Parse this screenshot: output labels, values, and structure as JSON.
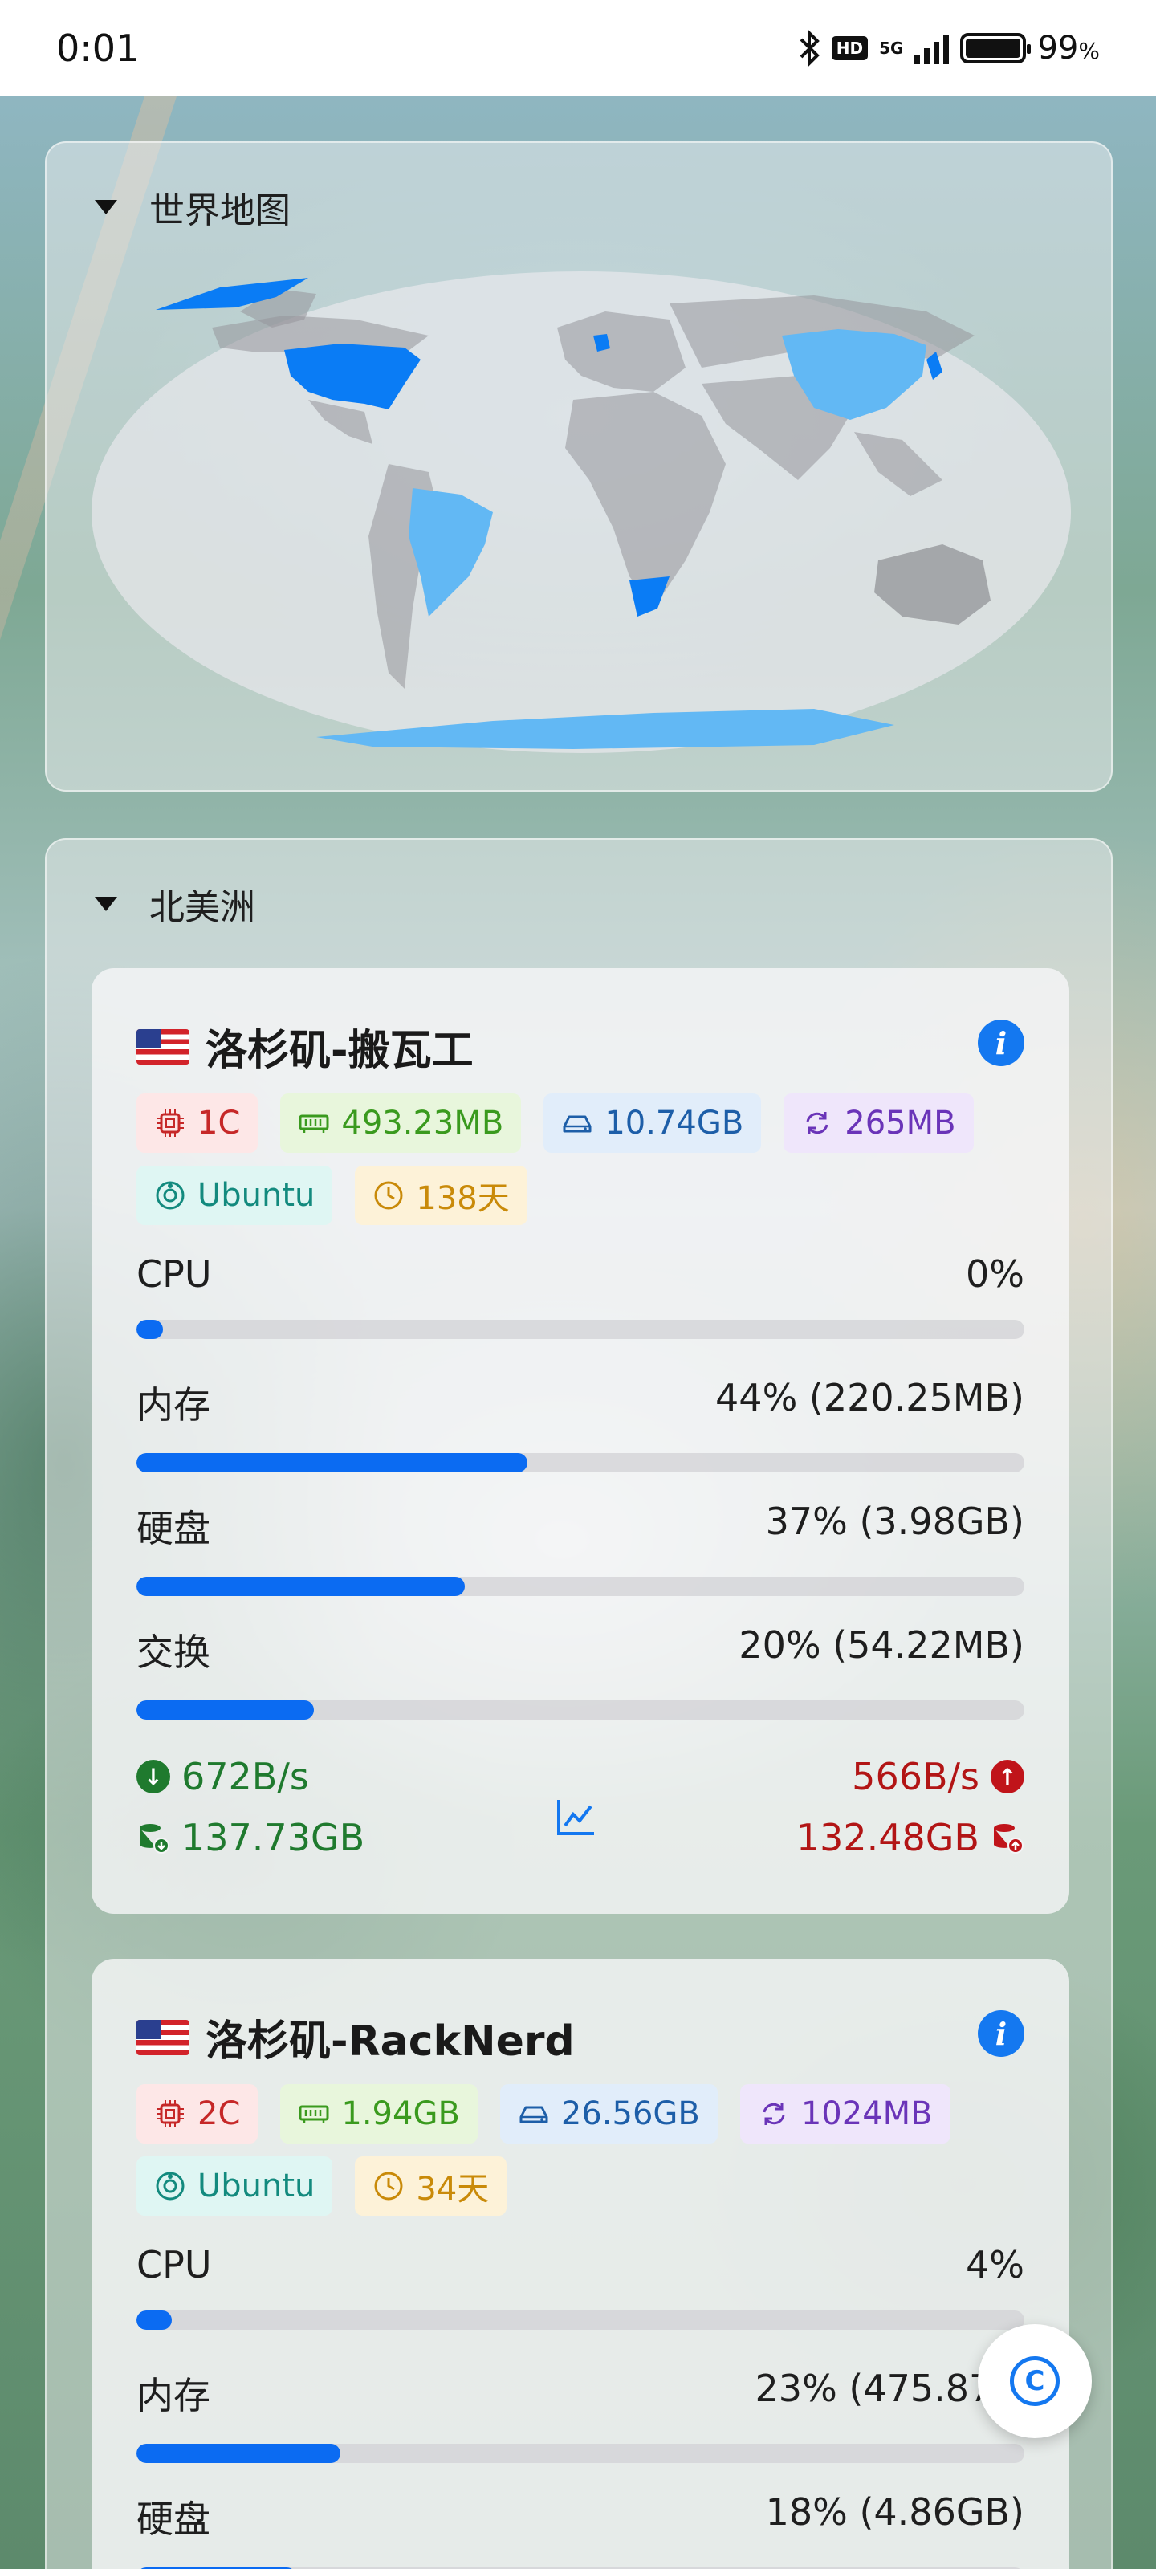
{
  "status_bar": {
    "time": "0:01",
    "network": "5G",
    "hd": "HD",
    "battery_level": "99",
    "battery_symbol": "%"
  },
  "world_panel": {
    "title": "世界地图"
  },
  "region_panel": {
    "title": "北美洲"
  },
  "servers": [
    {
      "name": "洛杉矶-搬瓦工",
      "flag": "us-flag",
      "tags": {
        "cpu": "1C",
        "ram": "493.23MB",
        "disk": "10.74GB",
        "swap": "265MB",
        "os": "Ubuntu",
        "uptime": "138天"
      },
      "metrics": [
        {
          "label": "CPU",
          "value": "0%",
          "percent": 0
        },
        {
          "label": "内存",
          "value": "44% (220.25MB)",
          "percent": 44
        },
        {
          "label": "硬盘",
          "value": "37% (3.98GB)",
          "percent": 37
        },
        {
          "label": "交换",
          "value": "20% (54.22MB)",
          "percent": 20
        }
      ],
      "network": {
        "down_speed": "672B/s",
        "down_total": "137.73GB",
        "up_speed": "566B/s",
        "up_total": "132.48GB"
      }
    },
    {
      "name": "洛杉矶-RackNerd",
      "flag": "us-flag",
      "tags": {
        "cpu": "2C",
        "ram": "1.94GB",
        "disk": "26.56GB",
        "swap": "1024MB",
        "os": "Ubuntu",
        "uptime": "34天"
      },
      "metrics": [
        {
          "label": "CPU",
          "value": "4%",
          "percent": 4
        },
        {
          "label": "内存",
          "value": "23% (475.87M",
          "percent": 23
        },
        {
          "label": "硬盘",
          "value": "18% (4.86GB)",
          "percent": 18
        }
      ]
    }
  ],
  "colors": {
    "accent": "#0b6bf2",
    "map_highlight": "#0a7cf5",
    "map_light": "#62b8f4",
    "net_down": "#1f7a2e",
    "net_up": "#b21515"
  }
}
